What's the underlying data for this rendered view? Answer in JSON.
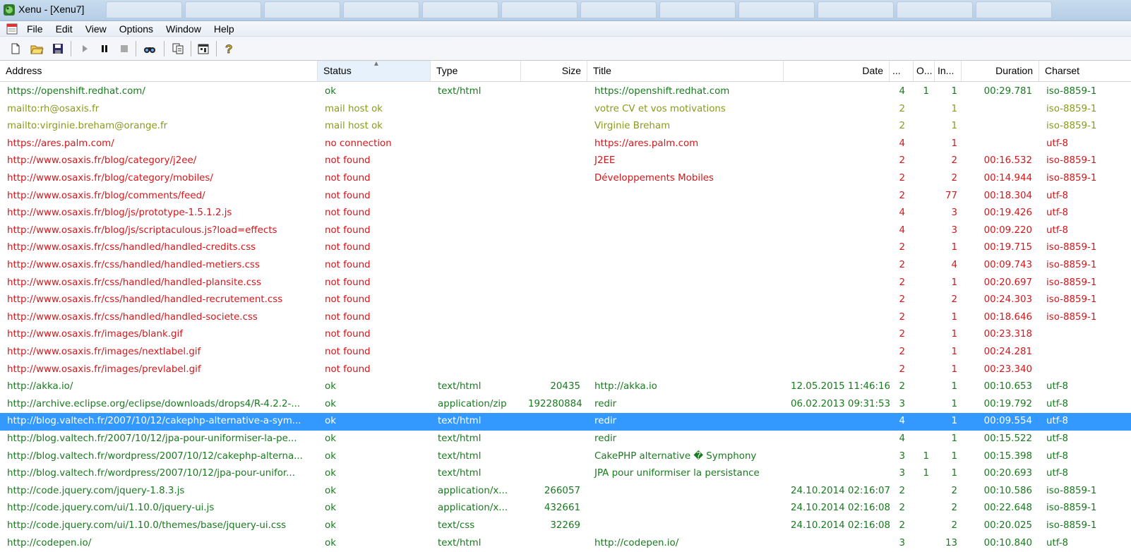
{
  "window": {
    "title": "Xenu - [Xenu7]",
    "icon": "xenu-app-icon"
  },
  "menu": {
    "items": [
      "File",
      "Edit",
      "View",
      "Options",
      "Window",
      "Help"
    ]
  },
  "toolbar": {
    "icons": [
      "new-icon",
      "open-icon",
      "save-icon",
      "play-icon",
      "pause-icon",
      "stop-icon",
      "find-icon",
      "copy-icon",
      "properties-icon",
      "help-icon"
    ]
  },
  "columns": [
    {
      "label": "Address"
    },
    {
      "label": "Status"
    },
    {
      "label": "Type"
    },
    {
      "label": "Size"
    },
    {
      "label": "Title"
    },
    {
      "label": "Date"
    },
    {
      "label": "..."
    },
    {
      "label": "O..."
    },
    {
      "label": "In..."
    },
    {
      "label": "Duration"
    },
    {
      "label": "Charset"
    }
  ],
  "colors": {
    "ok": "#197a1f",
    "mail": "#8a9a1d",
    "error": "#d6161a",
    "selected": "#3399ff"
  },
  "rows": [
    {
      "address": "https://openshift.redhat.com/",
      "status": "ok",
      "type": "text/html",
      "size": "",
      "title": "https://openshift.redhat.com",
      "date": "",
      "level": "4",
      "out": "1",
      "in": "1",
      "duration": "00:29.781",
      "charset": "iso-8859-1",
      "tone": "green"
    },
    {
      "address": "mailto:rh@osaxis.fr",
      "status": "mail host ok",
      "type": "",
      "size": "",
      "title": "votre CV et vos motivations",
      "date": "",
      "level": "2",
      "out": "",
      "in": "1",
      "duration": "",
      "charset": "iso-8859-1",
      "tone": "olive"
    },
    {
      "address": "mailto:virginie.breham@orange.fr",
      "status": "mail host ok",
      "type": "",
      "size": "",
      "title": "Virginie Breham",
      "date": "",
      "level": "2",
      "out": "",
      "in": "1",
      "duration": "",
      "charset": "iso-8859-1",
      "tone": "olive"
    },
    {
      "address": "https://ares.palm.com/",
      "status": "no connection",
      "type": "",
      "size": "",
      "title": "https://ares.palm.com",
      "date": "",
      "level": "4",
      "out": "",
      "in": "1",
      "duration": "",
      "charset": "utf-8",
      "tone": "red"
    },
    {
      "address": "http://www.osaxis.fr/blog/category/j2ee/",
      "status": "not found",
      "type": "",
      "size": "",
      "title": "J2EE",
      "date": "",
      "level": "2",
      "out": "",
      "in": "2",
      "duration": "00:16.532",
      "charset": "iso-8859-1",
      "tone": "red"
    },
    {
      "address": "http://www.osaxis.fr/blog/category/mobiles/",
      "status": "not found",
      "type": "",
      "size": "",
      "title": "Développements Mobiles",
      "date": "",
      "level": "2",
      "out": "",
      "in": "2",
      "duration": "00:14.944",
      "charset": "iso-8859-1",
      "tone": "red"
    },
    {
      "address": "http://www.osaxis.fr/blog/comments/feed/",
      "status": "not found",
      "type": "",
      "size": "",
      "title": "",
      "date": "",
      "level": "2",
      "out": "",
      "in": "77",
      "duration": "00:18.304",
      "charset": "utf-8",
      "tone": "red"
    },
    {
      "address": "http://www.osaxis.fr/blog/js/prototype-1.5.1.2.js",
      "status": "not found",
      "type": "",
      "size": "",
      "title": "",
      "date": "",
      "level": "4",
      "out": "",
      "in": "3",
      "duration": "00:19.426",
      "charset": "utf-8",
      "tone": "red"
    },
    {
      "address": "http://www.osaxis.fr/blog/js/scriptaculous.js?load=effects",
      "status": "not found",
      "type": "",
      "size": "",
      "title": "",
      "date": "",
      "level": "4",
      "out": "",
      "in": "3",
      "duration": "00:09.220",
      "charset": "utf-8",
      "tone": "red"
    },
    {
      "address": "http://www.osaxis.fr/css/handled/handled-credits.css",
      "status": "not found",
      "type": "",
      "size": "",
      "title": "",
      "date": "",
      "level": "2",
      "out": "",
      "in": "1",
      "duration": "00:19.715",
      "charset": "iso-8859-1",
      "tone": "red"
    },
    {
      "address": "http://www.osaxis.fr/css/handled/handled-metiers.css",
      "status": "not found",
      "type": "",
      "size": "",
      "title": "",
      "date": "",
      "level": "2",
      "out": "",
      "in": "4",
      "duration": "00:09.743",
      "charset": "iso-8859-1",
      "tone": "red"
    },
    {
      "address": "http://www.osaxis.fr/css/handled/handled-plansite.css",
      "status": "not found",
      "type": "",
      "size": "",
      "title": "",
      "date": "",
      "level": "2",
      "out": "",
      "in": "1",
      "duration": "00:20.697",
      "charset": "iso-8859-1",
      "tone": "red"
    },
    {
      "address": "http://www.osaxis.fr/css/handled/handled-recrutement.css",
      "status": "not found",
      "type": "",
      "size": "",
      "title": "",
      "date": "",
      "level": "2",
      "out": "",
      "in": "2",
      "duration": "00:24.303",
      "charset": "iso-8859-1",
      "tone": "red"
    },
    {
      "address": "http://www.osaxis.fr/css/handled/handled-societe.css",
      "status": "not found",
      "type": "",
      "size": "",
      "title": "",
      "date": "",
      "level": "2",
      "out": "",
      "in": "1",
      "duration": "00:18.646",
      "charset": "iso-8859-1",
      "tone": "red"
    },
    {
      "address": "http://www.osaxis.fr/images/blank.gif",
      "status": "not found",
      "type": "",
      "size": "",
      "title": "",
      "date": "",
      "level": "2",
      "out": "",
      "in": "1",
      "duration": "00:23.318",
      "charset": "",
      "tone": "red"
    },
    {
      "address": "http://www.osaxis.fr/images/nextlabel.gif",
      "status": "not found",
      "type": "",
      "size": "",
      "title": "",
      "date": "",
      "level": "2",
      "out": "",
      "in": "1",
      "duration": "00:24.281",
      "charset": "",
      "tone": "red"
    },
    {
      "address": "http://www.osaxis.fr/images/prevlabel.gif",
      "status": "not found",
      "type": "",
      "size": "",
      "title": "",
      "date": "",
      "level": "2",
      "out": "",
      "in": "1",
      "duration": "00:23.340",
      "charset": "",
      "tone": "red"
    },
    {
      "address": "http://akka.io/",
      "status": "ok",
      "type": "text/html",
      "size": "20435",
      "title": "http://akka.io",
      "date": "12.05.2015  11:46:16",
      "level": "2",
      "out": "",
      "in": "1",
      "duration": "00:10.653",
      "charset": "utf-8",
      "tone": "green"
    },
    {
      "address": "http://archive.eclipse.org/eclipse/downloads/drops4/R-4.2.2-...",
      "status": "ok",
      "type": "application/zip",
      "size": "192280884",
      "title": "redir",
      "date": "06.02.2013  09:31:53",
      "level": "3",
      "out": "",
      "in": "1",
      "duration": "00:19.792",
      "charset": "utf-8",
      "tone": "green"
    },
    {
      "address": "http://blog.valtech.fr/2007/10/12/cakephp-alternative-a-sym...",
      "status": "ok",
      "type": "text/html",
      "size": "",
      "title": "redir",
      "date": "",
      "level": "4",
      "out": "",
      "in": "1",
      "duration": "00:09.554",
      "charset": "utf-8",
      "tone": "green",
      "selected": true
    },
    {
      "address": "http://blog.valtech.fr/2007/10/12/jpa-pour-uniformiser-la-pe...",
      "status": "ok",
      "type": "text/html",
      "size": "",
      "title": "redir",
      "date": "",
      "level": "4",
      "out": "",
      "in": "1",
      "duration": "00:15.522",
      "charset": "utf-8",
      "tone": "green"
    },
    {
      "address": "http://blog.valtech.fr/wordpress/2007/10/12/cakephp-alterna...",
      "status": "ok",
      "type": "text/html",
      "size": "",
      "title": "CakePHP alternative � Symphony",
      "date": "",
      "level": "3",
      "out": "1",
      "in": "1",
      "duration": "00:15.398",
      "charset": "utf-8",
      "tone": "green"
    },
    {
      "address": "http://blog.valtech.fr/wordpress/2007/10/12/jpa-pour-unifor...",
      "status": "ok",
      "type": "text/html",
      "size": "",
      "title": "JPA pour uniformiser la persistance",
      "date": "",
      "level": "3",
      "out": "1",
      "in": "1",
      "duration": "00:20.693",
      "charset": "utf-8",
      "tone": "green"
    },
    {
      "address": "http://code.jquery.com/jquery-1.8.3.js",
      "status": "ok",
      "type": "application/x...",
      "size": "266057",
      "title": "",
      "date": "24.10.2014  02:16:07",
      "level": "2",
      "out": "",
      "in": "2",
      "duration": "00:10.586",
      "charset": "iso-8859-1",
      "tone": "green"
    },
    {
      "address": "http://code.jquery.com/ui/1.10.0/jquery-ui.js",
      "status": "ok",
      "type": "application/x...",
      "size": "432661",
      "title": "",
      "date": "24.10.2014  02:16:08",
      "level": "2",
      "out": "",
      "in": "2",
      "duration": "00:22.648",
      "charset": "iso-8859-1",
      "tone": "green"
    },
    {
      "address": "http://code.jquery.com/ui/1.10.0/themes/base/jquery-ui.css",
      "status": "ok",
      "type": "text/css",
      "size": "32269",
      "title": "",
      "date": "24.10.2014  02:16:08",
      "level": "2",
      "out": "",
      "in": "2",
      "duration": "00:20.025",
      "charset": "iso-8859-1",
      "tone": "green"
    },
    {
      "address": "http://codepen.io/",
      "status": "ok",
      "type": "text/html",
      "size": "",
      "title": "http://codepen.io/",
      "date": "",
      "level": "3",
      "out": "",
      "in": "13",
      "duration": "00:10.840",
      "charset": "utf-8",
      "tone": "green"
    }
  ]
}
